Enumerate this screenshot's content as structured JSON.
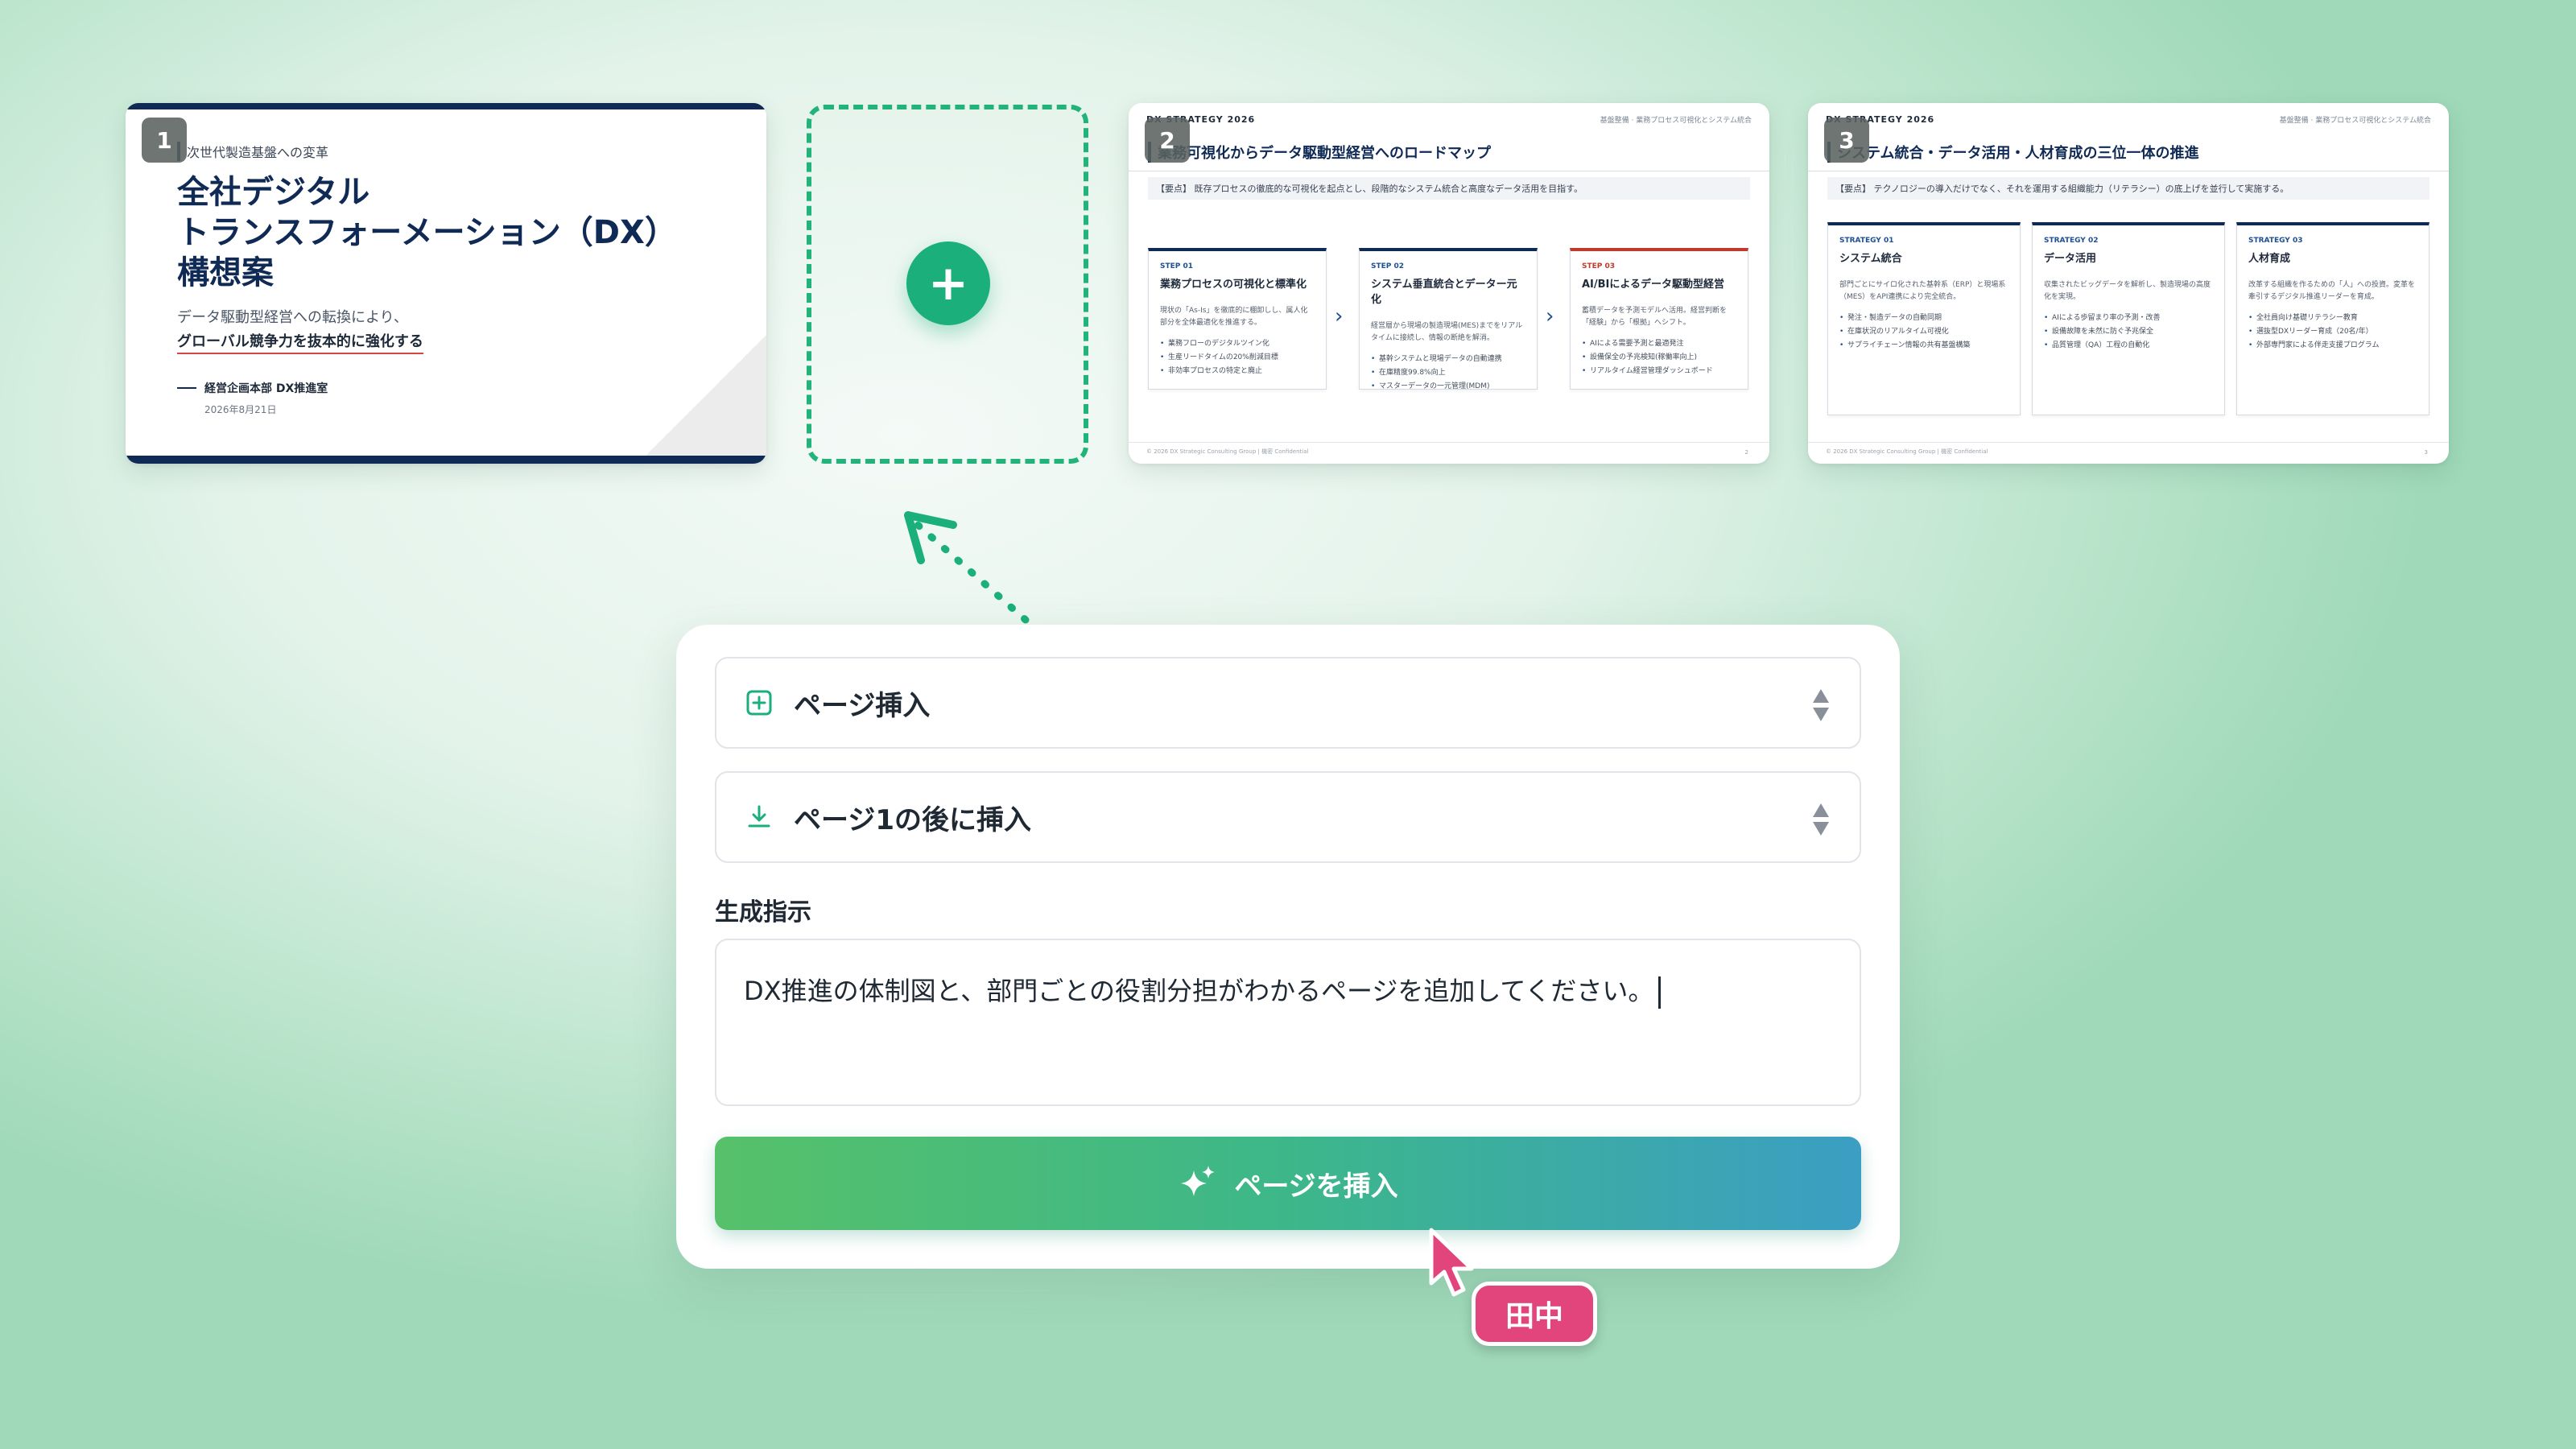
{
  "colors": {
    "accent_green": "#1aaf7b",
    "navy": "#0f2a55",
    "cta_gradient_start": "#56c16a",
    "cta_gradient_end": "#3b9ec3",
    "user_tag": "#e2457b"
  },
  "thumbnails": {
    "slide1": {
      "number": "1",
      "eyebrow": "次世代製造基盤への変革",
      "title_line1": "全社デジタル",
      "title_line2": "トランスフォーメーション（DX）",
      "title_line3": "構想案",
      "subtitle_line1": "データ駆動型経営への転換により、",
      "subtitle_line2": "グローバル競争力を抜本的に強化する",
      "department": "経営企画本部 DX推進室",
      "date": "2026年8月21日"
    },
    "slide2": {
      "number": "2",
      "brand": "DX STRATEGY 2026",
      "breadcrumb": "基盤整備 · 業務プロセス可視化とシステム統合",
      "title": "業務可視化からデータ駆動型経営へのロードマップ",
      "point": "【要点】 既存プロセスの徹底的な可視化を起点とし、段階的なシステム統合と高度なデータ活用を目指す。",
      "cards": [
        {
          "step": "STEP 01",
          "title": "業務プロセスの可視化と標準化",
          "desc": "現状の「As-Is」を徹底的に棚卸しし、属人化部分を全体最適化を推進する。",
          "items": [
            "業務フローのデジタルツイン化",
            "生産リードタイムの20%削減目標",
            "非効率プロセスの特定と廃止"
          ]
        },
        {
          "step": "STEP 02",
          "title": "システム垂直統合とデーター元化",
          "desc": "経営層から現場の製造現場(MES)までをリアルタイムに接続し、情報の断絶を解消。",
          "items": [
            "基幹システムと現場データの自動連携",
            "在庫精度99.8%向上",
            "マスターデータの一元管理(MDM)"
          ]
        },
        {
          "step": "STEP 03",
          "title": "AI/BIによるデータ駆動型経営",
          "desc": "蓄積データを予測モデルへ活用。経営判断を「経験」から「根拠」へシフト。",
          "items": [
            "AIによる需要予測と最適発注",
            "設備保全の予兆検知(稼働率向上)",
            "リアルタイム経営管理ダッシュボード"
          ]
        }
      ],
      "footer_left": "© 2026 DX Strategic Consulting Group | 機密 Confidential",
      "footer_right": "2"
    },
    "slide3": {
      "number": "3",
      "brand": "DX STRATEGY 2026",
      "breadcrumb": "基盤整備 · 業務プロセス可視化とシステム統合",
      "title": "システム統合・データ活用・人材育成の三位一体の推進",
      "point": "【要点】 テクノロジーの導入だけでなく、それを運用する組織能力（リテラシー）の底上げを並行して実施する。",
      "cards": [
        {
          "step": "STRATEGY 01",
          "title": "システム統合",
          "desc": "部門ごとにサイロ化された基幹系（ERP）と現場系（MES）をAPI連携により完全統合。",
          "items": [
            "発注・製造データの自動同期",
            "在庫状況のリアルタイム可視化",
            "サプライチェーン情報の共有基盤構築"
          ]
        },
        {
          "step": "STRATEGY 02",
          "title": "データ活用",
          "desc": "収集されたビッグデータを解析し、製造現場の高度化を実現。",
          "items": [
            "AIによる歩留まり率の予測・改善",
            "設備故障を未然に防ぐ予兆保全",
            "品質管理（QA）工程の自動化"
          ]
        },
        {
          "step": "STRATEGY 03",
          "title": "人材育成",
          "desc": "改革する組織を作るための「人」への投資。変革を牽引するデジタル推進リーダーを育成。",
          "items": [
            "全社員向け基礎リテラシー教育",
            "選抜型DXリーダー育成（20名/年）",
            "外部専門家による伴走支援プログラム"
          ]
        }
      ],
      "footer_left": "© 2026 DX Strategic Consulting Group | 機密 Confidential",
      "footer_right": "3"
    }
  },
  "insert_slot": {
    "icon": "plus-icon"
  },
  "panel": {
    "action_select": {
      "icon": "plus-square-icon",
      "value": "ページ挿入"
    },
    "position_select": {
      "icon": "download-icon",
      "value": "ページ1の後に挿入"
    },
    "instruction_label": "生成指示",
    "instruction_value": "DX推進の体制図と、部門ごとの役割分担がわかるページを追加してください。",
    "submit_button": {
      "icon": "sparkle-icon",
      "label": "ページを挿入"
    }
  },
  "collaborator": {
    "name": "田中"
  }
}
